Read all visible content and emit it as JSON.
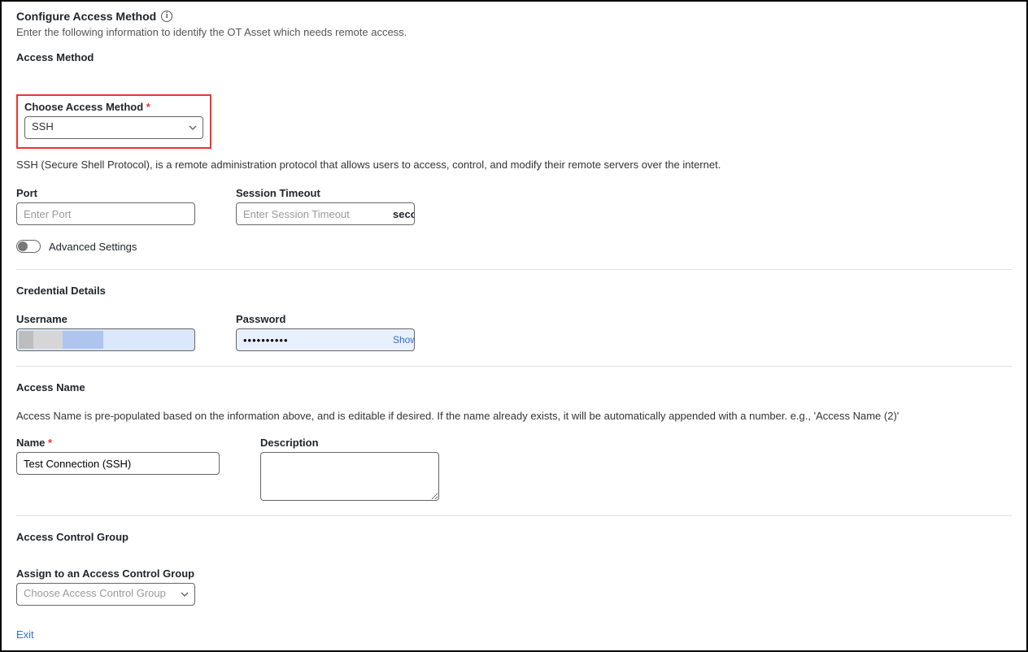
{
  "header": {
    "title": "Configure Access Method",
    "subtitle": "Enter the following information to identify the OT Asset which needs remote access."
  },
  "accessMethod": {
    "heading": "Access Method",
    "chooseLabel": "Choose Access Method",
    "chooseValue": "SSH",
    "description": "SSH (Secure Shell Protocol), is a remote administration protocol that allows users to access, control, and modify their remote servers over the internet.",
    "portLabel": "Port",
    "portPlaceholder": "Enter Port",
    "timeoutLabel": "Session Timeout",
    "timeoutPlaceholder": "Enter Session Timeout",
    "timeoutUnit": "seconds",
    "advancedLabel": "Advanced Settings"
  },
  "credentials": {
    "heading": "Credential Details",
    "usernameLabel": "Username",
    "passwordLabel": "Password",
    "passwordValue": "••••••••••",
    "showLabel": "Show"
  },
  "accessName": {
    "heading": "Access Name",
    "description": "Access Name is pre-populated based on the information above, and is editable if desired. If the name already exists, it will be automatically appended with a number. e.g., 'Access Name (2)'",
    "nameLabel": "Name",
    "nameValue": "Test Connection (SSH)",
    "descriptionLabel": "Description"
  },
  "acg": {
    "heading": "Access Control Group",
    "assignLabel": "Assign to an Access Control Group",
    "placeholder": "Choose Access Control Group"
  },
  "footer": {
    "exit": "Exit"
  }
}
